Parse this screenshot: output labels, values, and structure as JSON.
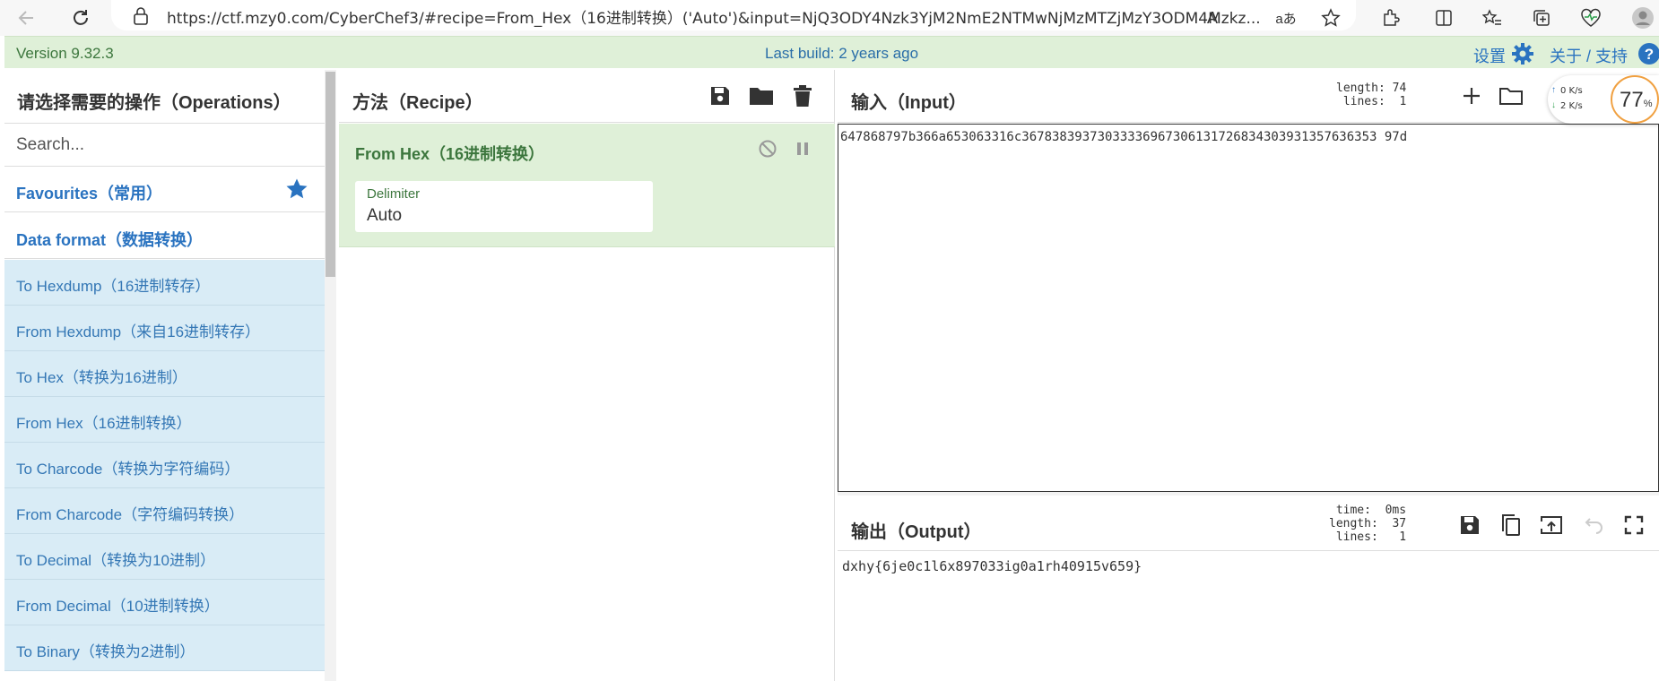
{
  "browser": {
    "url": "https://ctf.mzy0.com/CyberChef3/#recipe=From_Hex（16进制转换）('Auto')&input=NjQ3ODY4Nzk3YjM2NmE2NTMwNjMzMTZjMzY3ODM4Mzkz...",
    "read_aloud_label": "A",
    "translate_label": "aあ"
  },
  "banner": {
    "version": "Version 9.32.3",
    "last_build": "Last build: 2 years ago",
    "settings_label": "设置",
    "about_label": "关于 / 支持"
  },
  "operations": {
    "title": "请选择需要的操作（Operations）",
    "search_placeholder": "Search...",
    "favourites_label": "Favourites（常用）",
    "data_format_label": "Data format（数据转换）",
    "items": [
      "To Hexdump（16进制转存）",
      "From Hexdump（来自16进制转存）",
      "To Hex（转换为16进制）",
      "From Hex（16进制转换）",
      "To Charcode（转换为字符编码）",
      "From Charcode（字符编码转换）",
      "To Decimal（转换为10进制）",
      "From Decimal（10进制转换）",
      "To Binary（转换为2进制）"
    ]
  },
  "recipe": {
    "title": "方法（Recipe）",
    "operation_name": "From Hex（16进制转换）",
    "delimiter_label": "Delimiter",
    "delimiter_value": "Auto"
  },
  "input": {
    "title": "输入（Input）",
    "stats": "length: 74\n lines:  1",
    "text": "647868797b366a653063316c36783839373033336967306131726834303931357636353 97d"
  },
  "output": {
    "title": "输出（Output）",
    "stats": "time:  0ms\nlength:  37\nlines:   1",
    "text": "dxhy{6je0c1l6x897033ig0a1rh40915v659}"
  },
  "speed_widget": {
    "upload": "0  K/s",
    "download": "2  K/s",
    "percent": "77",
    "percent_sign": "%"
  },
  "colors": {
    "banner_bg": "#dff0d8",
    "link_blue": "#2a73c0",
    "op_item_bg": "#d9ecf6",
    "recipe_green": "#3c763d"
  }
}
